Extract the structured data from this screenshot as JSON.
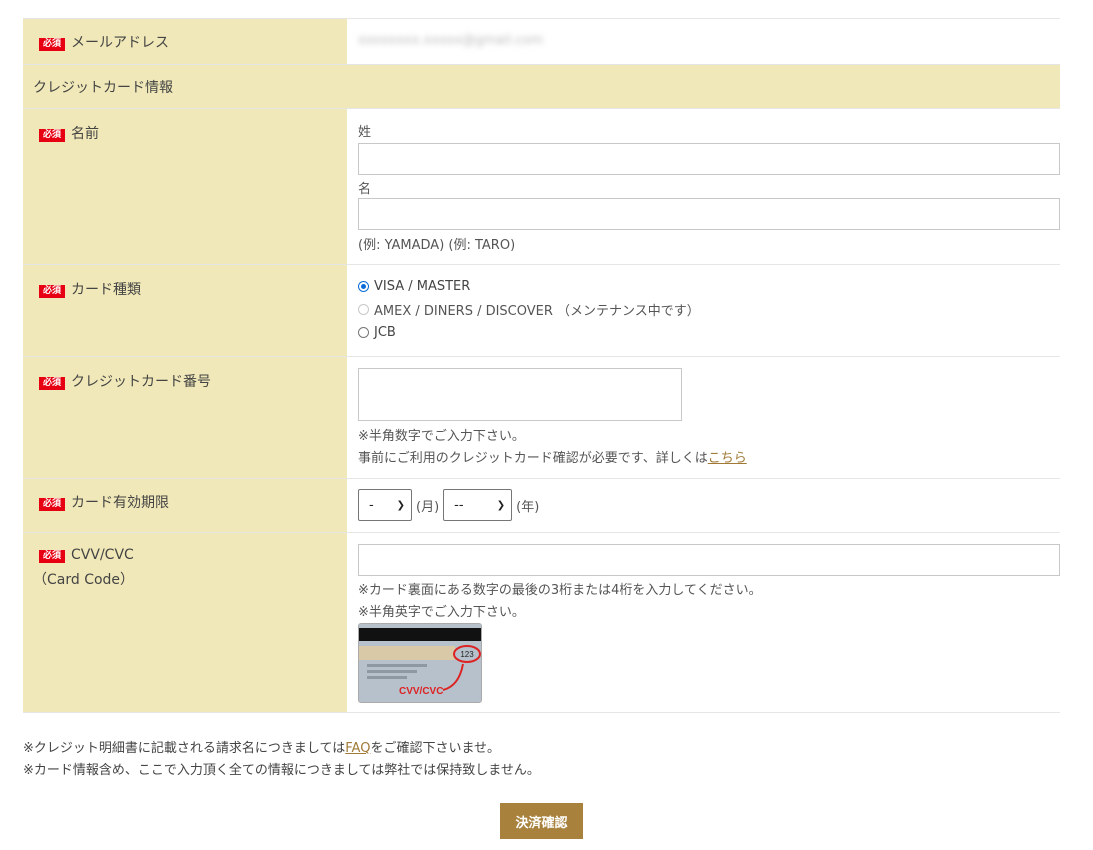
{
  "required_badge": "必須",
  "email": {
    "label": "メールアドレス",
    "value": "xxxxxxxx.xxxxx@gmail.com"
  },
  "section_title": "クレジットカード情報",
  "name": {
    "label": "名前",
    "last_label": "姓",
    "first_label": "名",
    "example": "(例: YAMADA) (例: TARO)"
  },
  "card_type": {
    "label": "カード種類",
    "options": [
      {
        "label": "VISA / MASTER",
        "state": "checked"
      },
      {
        "label": "AMEX / DINERS / DISCOVER （メンテナンス中です）",
        "state": "disabled"
      },
      {
        "label": "JCB",
        "state": "unchecked"
      }
    ]
  },
  "card_number": {
    "label": "クレジットカード番号",
    "note1": "※半角数字でご入力下さい。",
    "note2": "事前にご利用のクレジットカード確認が必要です、詳しくは",
    "link": "こちら"
  },
  "expiry": {
    "label": "カード有効期限",
    "month_value": "-",
    "month_unit": "(月)",
    "year_value": "--",
    "year_unit": "(年)"
  },
  "cvv": {
    "label": "CVV/CVC",
    "sublabel": "（Card Code）",
    "note1": "※カード裏面にある数字の最後の3桁または4桁を入力してください。",
    "note2": "※半角英字でご入力下さい。",
    "image_code": "123",
    "image_caption": "CVV/CVC"
  },
  "footer": {
    "note1_pre": "※クレジット明細書に記載される請求名につきましては",
    "note1_link": "FAQ",
    "note1_post": "をご確認下さいませ。",
    "note2": "※カード情報含め、ここで入力頂く全ての情報につきましては弊社では保持致しません。"
  },
  "submit_label": "決済確認",
  "colors": {
    "accent": "#a8823d",
    "required": "#e60012",
    "header_bg": "#f0e8b8"
  }
}
